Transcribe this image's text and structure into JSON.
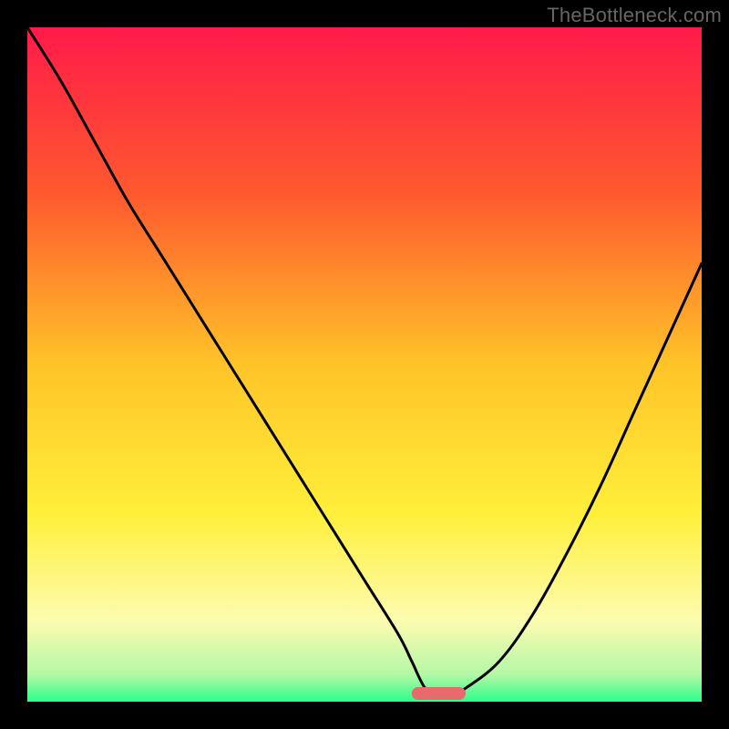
{
  "watermark": "TheBottleneck.com",
  "chart_data": {
    "type": "line",
    "title": "",
    "xlabel": "",
    "ylabel": "",
    "xlim": [
      0,
      100
    ],
    "ylim": [
      0,
      100
    ],
    "series": [
      {
        "name": "bottleneck-curve",
        "x": [
          0,
          5,
          10,
          15,
          20,
          25,
          30,
          35,
          40,
          45,
          50,
          55,
          57,
          59,
          61,
          63,
          65,
          70,
          75,
          80,
          85,
          90,
          95,
          100
        ],
        "y": [
          100,
          92,
          83,
          74,
          66,
          58,
          50,
          42,
          34,
          26,
          18,
          10,
          6,
          2,
          1,
          1,
          2,
          6,
          13,
          22,
          32,
          43,
          54,
          65
        ]
      }
    ],
    "marker": {
      "name": "optimal-zone",
      "x_center": 61,
      "width": 8,
      "color": "#e86a6a"
    },
    "gradient_stops": [
      {
        "pct": 0,
        "color": "#ff1a4a"
      },
      {
        "pct": 25,
        "color": "#ff5a2e"
      },
      {
        "pct": 50,
        "color": "#ffc428"
      },
      {
        "pct": 72,
        "color": "#ffef3a"
      },
      {
        "pct": 88,
        "color": "#fdfcb0"
      },
      {
        "pct": 96,
        "color": "#b4f7a6"
      },
      {
        "pct": 100,
        "color": "#2aff8a"
      }
    ]
  }
}
